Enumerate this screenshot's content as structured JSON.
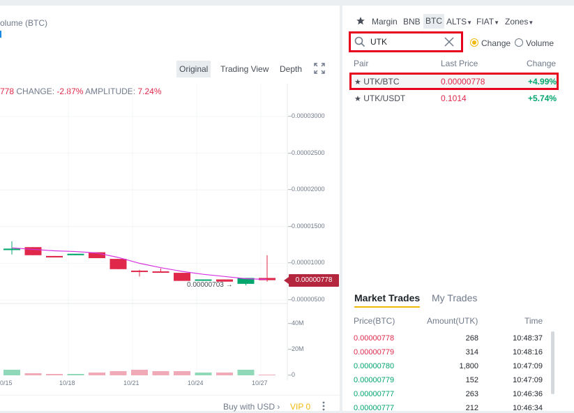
{
  "chart_header": {
    "volume_label": "olume (BTC)",
    "ohlc_prefix": "778",
    "change_label": "CHANGE:",
    "change_value": "-2.87%",
    "amplitude_label": "AMPLITUDE:",
    "amplitude_value": "7.24%"
  },
  "view_tabs": [
    "Original",
    "Trading View",
    "Depth"
  ],
  "price_axis": [
    "0.00003000",
    "0.00002500",
    "0.00002000",
    "0.00001500",
    "0.00001000",
    "0.00000500"
  ],
  "volume_axis": [
    "40M",
    "20M",
    "0"
  ],
  "date_axis": [
    "0/15",
    "10/18",
    "10/21",
    "10/24",
    "10/27"
  ],
  "current_price_tag": "0.00000778",
  "low_marker": "0.00000703",
  "colors": {
    "up": "#03a66d",
    "down": "#e0294a",
    "ma": "#d633e0",
    "accent": "#f0b90b"
  },
  "chart_data": {
    "type": "candlestick",
    "candles": [
      {
        "o": 1.18e-05,
        "c": 1.2e-05,
        "h": 1.3e-05,
        "l": 1.12e-05
      },
      {
        "o": 1.22e-05,
        "c": 1.11e-05,
        "h": 1.22e-05,
        "l": 1.11e-05
      },
      {
        "o": 1.1e-05,
        "c": 1.08e-05,
        "h": 1.1e-05,
        "l": 1.08e-05
      },
      {
        "o": 1.11e-05,
        "c": 1.13e-05,
        "h": 1.13e-05,
        "l": 1.11e-05
      },
      {
        "o": 1.15e-05,
        "c": 1.07e-05,
        "h": 1.15e-05,
        "l": 1.07e-05
      },
      {
        "o": 1.06e-05,
        "c": 9.2e-06,
        "h": 1.06e-05,
        "l": 9.2e-06
      },
      {
        "o": 9e-06,
        "c": 8.9e-06,
        "h": 9.1e-06,
        "l": 8.2e-06
      },
      {
        "o": 8.9e-06,
        "c": 8.8e-06,
        "h": 9.3e-06,
        "l": 8.8e-06
      },
      {
        "o": 8.7e-06,
        "c": 7.6e-06,
        "h": 8.7e-06,
        "l": 7.6e-06
      },
      {
        "o": 7.7e-06,
        "c": 7.8e-06,
        "h": 7.8e-06,
        "l": 7.6e-06
      },
      {
        "o": 7.8e-06,
        "c": 7.5e-06,
        "h": 7.8e-06,
        "l": 7.5e-06
      },
      {
        "o": 7.2e-06,
        "c": 8e-06,
        "h": 8e-06,
        "l": 7e-06
      },
      {
        "o": 8e-06,
        "c": 7.7e-06,
        "h": 1.11e-05,
        "l": 7.5e-06
      }
    ],
    "volumes": [
      4,
      1.5,
      1,
      1,
      2,
      3,
      4,
      3,
      3,
      2,
      2,
      4,
      0.5
    ],
    "ylim": [
      4e-06,
      3.25e-05
    ]
  },
  "market_bar": {
    "margin": "Margin",
    "bnb": "BNB",
    "btc": "BTC",
    "alts": "ALTS",
    "fiat": "FIAT",
    "zones": "Zones"
  },
  "search": {
    "value": "UTK"
  },
  "sort_options": {
    "change": "Change",
    "volume": "Volume"
  },
  "pair_headers": {
    "pair": "Pair",
    "last_price": "Last Price",
    "change": "Change"
  },
  "pairs": [
    {
      "pair": "UTK/BTC",
      "price": "0.00000778",
      "change": "+4.99%"
    },
    {
      "pair": "UTK/USDT",
      "price": "0.1014",
      "change": "+5.74%"
    }
  ],
  "trades_tabs": {
    "market": "Market Trades",
    "mine": "My Trades"
  },
  "trade_headers": {
    "price": "Price(BTC)",
    "amount": "Amount(UTK)",
    "time": "Time"
  },
  "trades": [
    {
      "price": "0.00000778",
      "amount": "268",
      "time": "10:48:37",
      "side": "down"
    },
    {
      "price": "0.00000779",
      "amount": "314",
      "time": "10:48:16",
      "side": "down"
    },
    {
      "price": "0.00000780",
      "amount": "1,800",
      "time": "10:47:09",
      "side": "up"
    },
    {
      "price": "0.00000779",
      "amount": "152",
      "time": "10:47:09",
      "side": "up"
    },
    {
      "price": "0.00000777",
      "amount": "263",
      "time": "10:46:36",
      "side": "up"
    },
    {
      "price": "0.00000777",
      "amount": "212",
      "time": "10:46:34",
      "side": "up"
    }
  ],
  "footer": {
    "buy_usd": "Buy with USD",
    "vip": "VIP 0"
  }
}
